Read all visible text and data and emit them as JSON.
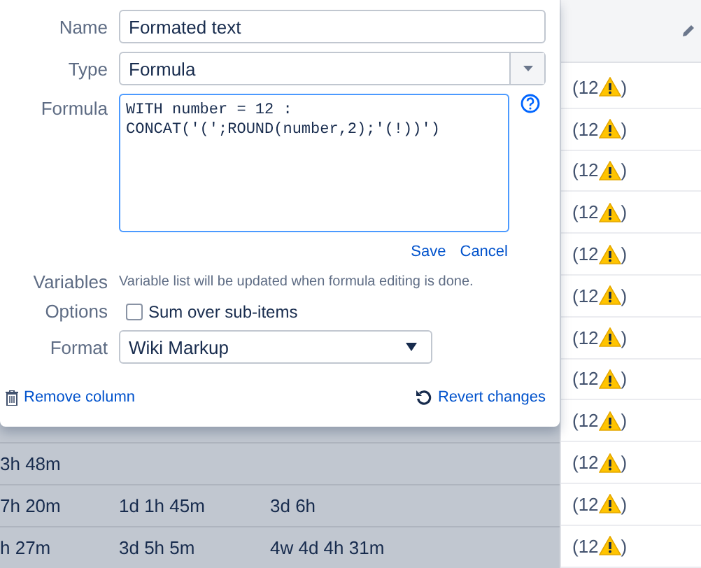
{
  "editor": {
    "name_field": {
      "label": "Name",
      "value": "Formated text"
    },
    "type_field": {
      "label": "Type",
      "value": "Formula"
    },
    "formula_field": {
      "label": "Formula",
      "value": "WITH number = 12 :\nCONCAT('(';ROUND(number,2);'(!))')"
    },
    "save": "Save",
    "cancel": "Cancel",
    "variables": {
      "label": "Variables",
      "text": "Variable list will be updated when formula editing is done."
    },
    "options": {
      "label": "Options",
      "checkbox_label": "Sum over sub-items",
      "checked": false
    },
    "format_field": {
      "label": "Format",
      "value": "Wiki Markup"
    },
    "remove_column": "Remove column",
    "revert_changes": "Revert changes"
  },
  "table": {
    "rows": [
      {
        "cells": [
          "3h 48m"
        ]
      },
      {
        "cells": [
          "7h 20m",
          "1d 1h 45m",
          "3d 6h"
        ]
      },
      {
        "cells": [
          "h 27m",
          "3d 5h 5m",
          "4w 4d 4h 31m"
        ]
      }
    ]
  },
  "formatted_column": {
    "rows": [
      {
        "prefix": "(12",
        "suffix": ")"
      },
      {
        "prefix": "(12",
        "suffix": ")"
      },
      {
        "prefix": "(12",
        "suffix": ")"
      },
      {
        "prefix": "(12",
        "suffix": ")"
      },
      {
        "prefix": "(12",
        "suffix": ")"
      },
      {
        "prefix": "(12",
        "suffix": ")"
      },
      {
        "prefix": "(12",
        "suffix": ")"
      },
      {
        "prefix": "(12",
        "suffix": ")"
      },
      {
        "prefix": "(12",
        "suffix": ")"
      },
      {
        "prefix": "(12",
        "suffix": ")"
      },
      {
        "prefix": "(12",
        "suffix": ")"
      },
      {
        "prefix": "(12",
        "suffix": ")"
      }
    ]
  }
}
